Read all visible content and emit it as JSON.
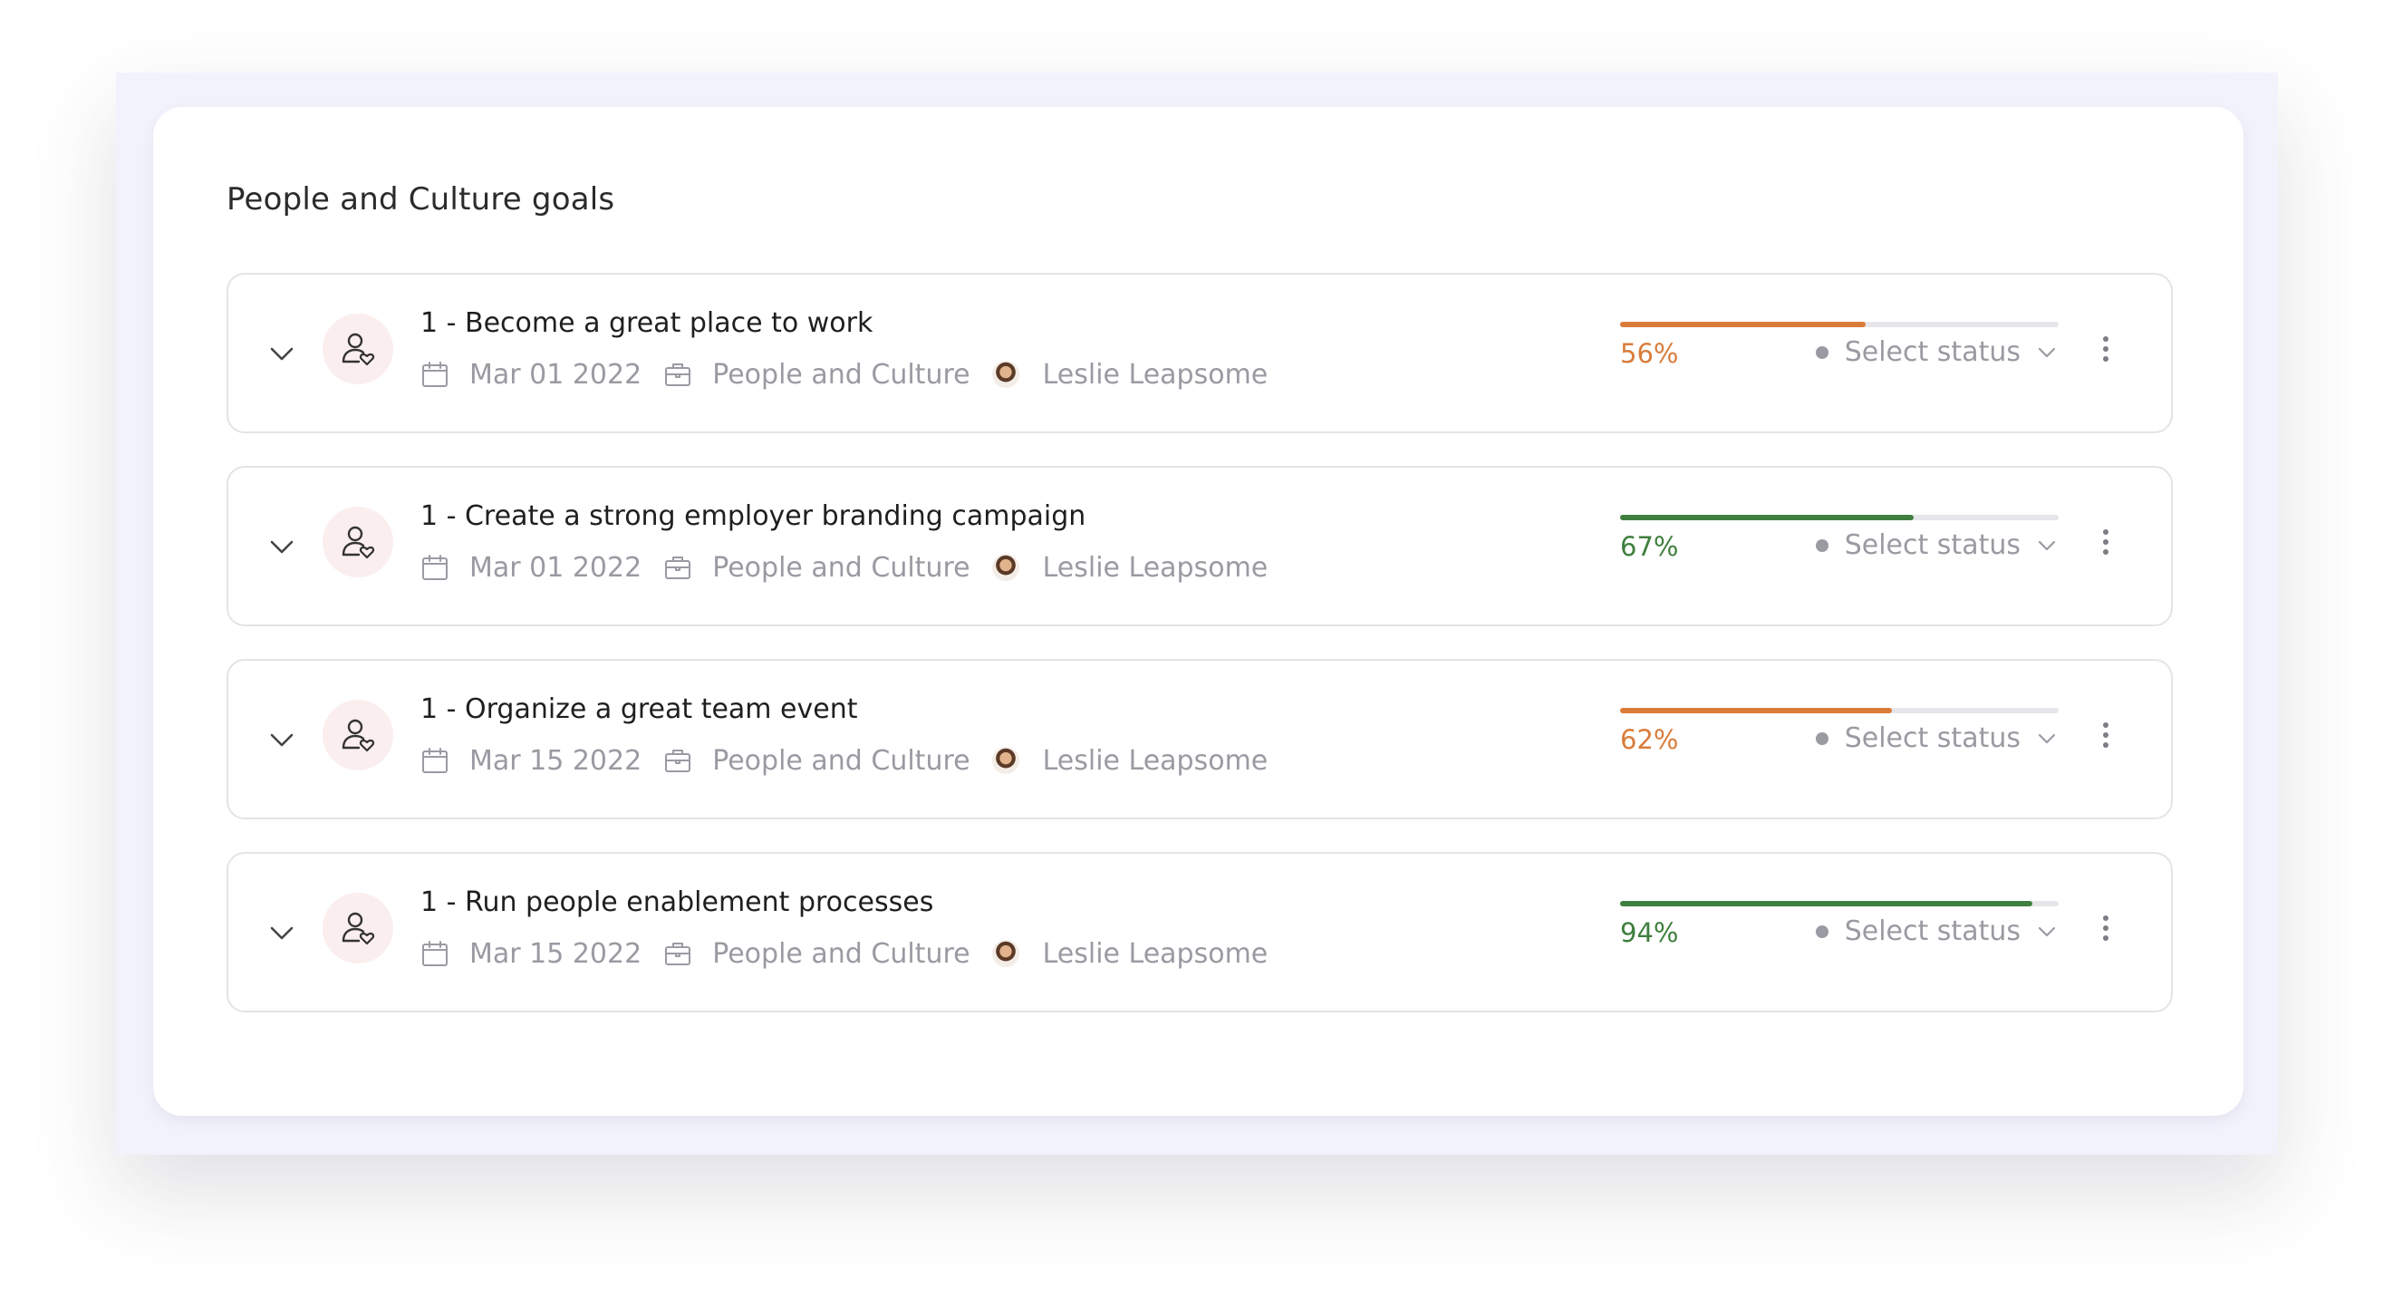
{
  "card": {
    "title": "People and Culture goals"
  },
  "colors": {
    "orange": "#d97c3a",
    "green": "#3f7f3f",
    "muted": "#9a9aa2"
  },
  "goals": [
    {
      "title": "1 - Become a great place to work",
      "date": "Mar 01 2022",
      "team": "People and Culture",
      "owner": "Leslie Leapsome",
      "progress": 0.56,
      "progress_label": "56%",
      "progress_color": "#d97c3a",
      "status": "Select status"
    },
    {
      "title": "1 - Create a strong employer branding campaign",
      "date": "Mar 01 2022",
      "team": "People and Culture",
      "owner": "Leslie Leapsome",
      "progress": 0.67,
      "progress_label": "67%",
      "progress_color": "#3f7f3f",
      "status": "Select status"
    },
    {
      "title": "1 - Organize a great team event",
      "date": "Mar 15 2022",
      "team": "People and Culture",
      "owner": "Leslie Leapsome",
      "progress": 0.62,
      "progress_label": "62%",
      "progress_color": "#d97c3a",
      "status": "Select status"
    },
    {
      "title": "1 - Run people enablement processes",
      "date": "Mar 15 2022",
      "team": "People and Culture",
      "owner": "Leslie Leapsome",
      "progress": 0.94,
      "progress_label": "94%",
      "progress_color": "#3f7f3f",
      "status": "Select status"
    }
  ],
  "icons": {
    "expand": "chevron-down-icon",
    "goal": "person-heart-icon",
    "date": "calendar-icon",
    "team": "briefcase-icon",
    "owner": "avatar",
    "menu": "more-vertical-icon"
  }
}
